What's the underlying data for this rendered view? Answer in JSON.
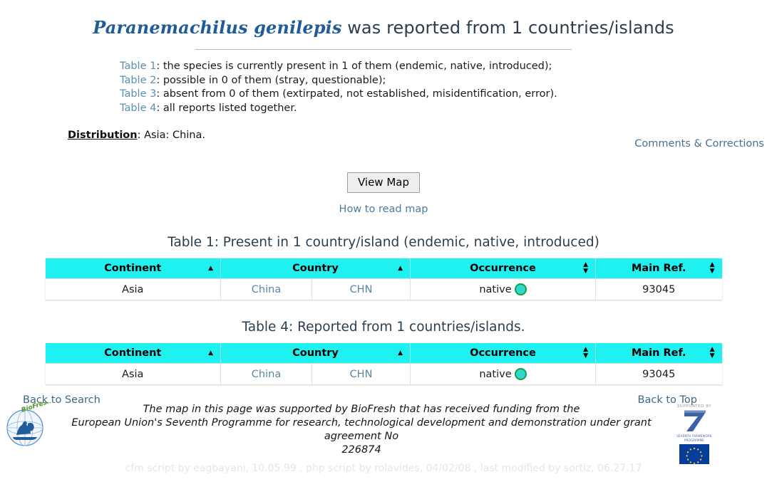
{
  "header": {
    "species": "Paranemachilus genilepis",
    "title_rest": " was reported from 1 countries/islands"
  },
  "legend": [
    {
      "link": "Table 1",
      "text": ": the species is currently present in 1 of them (endemic, native, introduced);"
    },
    {
      "link": "Table 2",
      "text": ": possible in 0 of them (stray, questionable);"
    },
    {
      "link": "Table 3",
      "text": ": absent from 0 of them (extirpated, not established, misidentification, error)."
    },
    {
      "link": "Table 4",
      "text": ": all reports listed together."
    }
  ],
  "distribution": {
    "label": "Distribution",
    "value": ": Asia: China."
  },
  "comments_link": "Comments & Corrections",
  "map": {
    "button_label": "View Map",
    "how_to_read": "How to read map"
  },
  "tables": [
    {
      "caption": "Table 1: Present in 1 country/island (endemic, native, introduced)",
      "columns": [
        {
          "label": "Continent",
          "sort": "asc"
        },
        {
          "label": "Country",
          "sort": "asc"
        },
        {
          "label": "Occurrence",
          "sort": "both"
        },
        {
          "label": "Main Ref.",
          "sort": "both"
        }
      ],
      "rows": [
        {
          "continent": "Asia",
          "country": "China",
          "country_code": "CHN",
          "occurrence": "native",
          "occurrence_marker": "native-circle-icon",
          "main_ref": "93045"
        }
      ]
    },
    {
      "caption": "Table 4: Reported from 1 countries/islands.",
      "columns": [
        {
          "label": "Continent",
          "sort": "asc"
        },
        {
          "label": "Country",
          "sort": "asc"
        },
        {
          "label": "Occurrence",
          "sort": "both"
        },
        {
          "label": "Main Ref.",
          "sort": "both"
        }
      ],
      "rows": [
        {
          "continent": "Asia",
          "country": "China",
          "country_code": "CHN",
          "occurrence": "native",
          "occurrence_marker": "native-circle-icon",
          "main_ref": "93045"
        }
      ]
    }
  ],
  "bottom_links": {
    "back_to_search": "Back to Search",
    "back_to_top": "Back to Top"
  },
  "footer": {
    "funding_line1": "The map in this page was supported by BioFresh that has received funding from the",
    "funding_line2": "European Union's Seventh Programme for research, technological development and demonstration under grant agreement No",
    "funding_line3": "226874",
    "credits": "cfm script by eagbayani, 10.05.99 ,  php script by rolavides, 04/02/08 ,  last modified by sortiz, 06.27.17",
    "biofresh_label": "BioFresh",
    "supported_by": "SUPPORTED BY",
    "fp7_label1": "SEVENTH FRAMEWORK",
    "fp7_label2": "PROGRAMME"
  },
  "colors": {
    "header_cyan": "#1ff0f0",
    "link_blue": "#5a86a3",
    "species_blue": "#1f5c99",
    "native_green": "#14a04a",
    "native_fill": "#2fd8c8"
  }
}
